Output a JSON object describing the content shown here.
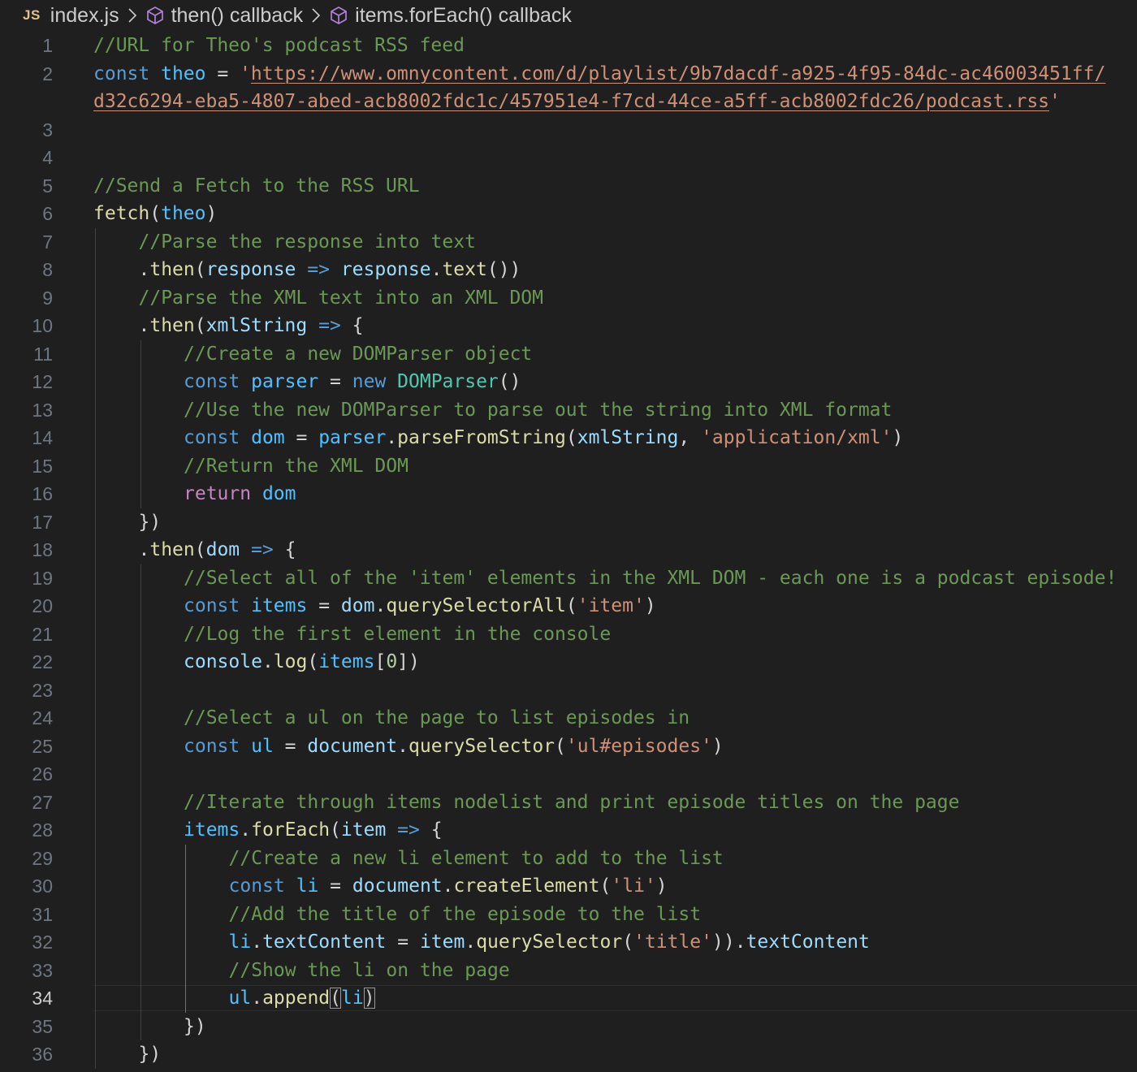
{
  "breadcrumb": {
    "file_badge": "JS",
    "file_name": "index.js",
    "crumbs": [
      "then() callback",
      "items.forEach() callback"
    ]
  },
  "editor": {
    "language": "javascript",
    "active_line": 34,
    "lines": [
      {
        "n": "1",
        "indent": 0,
        "tokens": [
          [
            "cmt",
            "//URL for Theo's podcast RSS feed"
          ]
        ]
      },
      {
        "n": "2",
        "indent": 0,
        "tokens": [
          [
            "kw",
            "const"
          ],
          [
            "pun",
            " "
          ],
          [
            "var",
            "theo"
          ],
          [
            "pun",
            " = "
          ],
          [
            "str",
            "'"
          ],
          [
            "url",
            "https://www.omnycontent.com/d/playlist/9b7dacdf-a925-4f95-84dc-ac46003451ff/"
          ]
        ]
      },
      {
        "n": "",
        "indent": 0,
        "tokens": [
          [
            "url",
            "d32c6294-eba5-4807-abed-acb8002fdc1c/457951e4-f7cd-44ce-a5ff-acb8002fdc26/podcast.rss"
          ],
          [
            "str",
            "'"
          ]
        ]
      },
      {
        "n": "3",
        "indent": 0,
        "tokens": []
      },
      {
        "n": "4",
        "indent": 0,
        "tokens": []
      },
      {
        "n": "5",
        "indent": 0,
        "tokens": [
          [
            "cmt",
            "//Send a Fetch to the RSS URL"
          ]
        ]
      },
      {
        "n": "6",
        "indent": 0,
        "tokens": [
          [
            "fn",
            "fetch"
          ],
          [
            "pun",
            "("
          ],
          [
            "var",
            "theo"
          ],
          [
            "pun",
            ")"
          ]
        ]
      },
      {
        "n": "7",
        "indent": 1,
        "tokens": [
          [
            "cmt",
            "//Parse the response into text"
          ]
        ]
      },
      {
        "n": "8",
        "indent": 1,
        "tokens": [
          [
            "pun",
            "."
          ],
          [
            "fn",
            "then"
          ],
          [
            "pun",
            "("
          ],
          [
            "prm",
            "response"
          ],
          [
            "pun",
            " "
          ],
          [
            "kw",
            "=>"
          ],
          [
            "pun",
            " "
          ],
          [
            "prm",
            "response"
          ],
          [
            "pun",
            "."
          ],
          [
            "fn",
            "text"
          ],
          [
            "pun",
            "())"
          ]
        ]
      },
      {
        "n": "9",
        "indent": 1,
        "tokens": [
          [
            "cmt",
            "//Parse the XML text into an XML DOM"
          ]
        ]
      },
      {
        "n": "10",
        "indent": 1,
        "tokens": [
          [
            "pun",
            "."
          ],
          [
            "fn",
            "then"
          ],
          [
            "pun",
            "("
          ],
          [
            "prm",
            "xmlString"
          ],
          [
            "pun",
            " "
          ],
          [
            "kw",
            "=>"
          ],
          [
            "pun",
            " {"
          ]
        ]
      },
      {
        "n": "11",
        "indent": 2,
        "tokens": [
          [
            "cmt",
            "//Create a new DOMParser object"
          ]
        ]
      },
      {
        "n": "12",
        "indent": 2,
        "tokens": [
          [
            "kw",
            "const"
          ],
          [
            "pun",
            " "
          ],
          [
            "var",
            "parser"
          ],
          [
            "pun",
            " = "
          ],
          [
            "kw",
            "new"
          ],
          [
            "pun",
            " "
          ],
          [
            "cls",
            "DOMParser"
          ],
          [
            "pun",
            "()"
          ]
        ]
      },
      {
        "n": "13",
        "indent": 2,
        "tokens": [
          [
            "cmt",
            "//Use the new DOMParser to parse out the string into XML format"
          ]
        ]
      },
      {
        "n": "14",
        "indent": 2,
        "tokens": [
          [
            "kw",
            "const"
          ],
          [
            "pun",
            " "
          ],
          [
            "var",
            "dom"
          ],
          [
            "pun",
            " = "
          ],
          [
            "var",
            "parser"
          ],
          [
            "pun",
            "."
          ],
          [
            "fn",
            "parseFromString"
          ],
          [
            "pun",
            "("
          ],
          [
            "prm",
            "xmlString"
          ],
          [
            "pun",
            ", "
          ],
          [
            "str",
            "'application/xml'"
          ],
          [
            "pun",
            ")"
          ]
        ]
      },
      {
        "n": "15",
        "indent": 2,
        "tokens": [
          [
            "cmt",
            "//Return the XML DOM"
          ]
        ]
      },
      {
        "n": "16",
        "indent": 2,
        "tokens": [
          [
            "ctl",
            "return"
          ],
          [
            "pun",
            " "
          ],
          [
            "var",
            "dom"
          ]
        ]
      },
      {
        "n": "17",
        "indent": 1,
        "tokens": [
          [
            "pun",
            "})"
          ]
        ]
      },
      {
        "n": "18",
        "indent": 1,
        "tokens": [
          [
            "pun",
            "."
          ],
          [
            "fn",
            "then"
          ],
          [
            "pun",
            "("
          ],
          [
            "prm",
            "dom"
          ],
          [
            "pun",
            " "
          ],
          [
            "kw",
            "=>"
          ],
          [
            "pun",
            " {"
          ]
        ]
      },
      {
        "n": "19",
        "indent": 2,
        "tokens": [
          [
            "cmt",
            "//Select all of the 'item' elements in the XML DOM - each one is a podcast episode!"
          ]
        ]
      },
      {
        "n": "20",
        "indent": 2,
        "tokens": [
          [
            "kw",
            "const"
          ],
          [
            "pun",
            " "
          ],
          [
            "var",
            "items"
          ],
          [
            "pun",
            " = "
          ],
          [
            "prm",
            "dom"
          ],
          [
            "pun",
            "."
          ],
          [
            "fn",
            "querySelectorAll"
          ],
          [
            "pun",
            "("
          ],
          [
            "str",
            "'item'"
          ],
          [
            "pun",
            ")"
          ]
        ]
      },
      {
        "n": "21",
        "indent": 2,
        "tokens": [
          [
            "cmt",
            "//Log the first element in the console"
          ]
        ]
      },
      {
        "n": "22",
        "indent": 2,
        "tokens": [
          [
            "prm",
            "console"
          ],
          [
            "pun",
            "."
          ],
          [
            "fn",
            "log"
          ],
          [
            "pun",
            "("
          ],
          [
            "var",
            "items"
          ],
          [
            "pun",
            "["
          ],
          [
            "num",
            "0"
          ],
          [
            "pun",
            "])"
          ]
        ]
      },
      {
        "n": "23",
        "indent": 2,
        "tokens": []
      },
      {
        "n": "24",
        "indent": 2,
        "tokens": [
          [
            "cmt",
            "//Select a ul on the page to list episodes in"
          ]
        ]
      },
      {
        "n": "25",
        "indent": 2,
        "tokens": [
          [
            "kw",
            "const"
          ],
          [
            "pun",
            " "
          ],
          [
            "var",
            "ul"
          ],
          [
            "pun",
            " = "
          ],
          [
            "prm",
            "document"
          ],
          [
            "pun",
            "."
          ],
          [
            "fn",
            "querySelector"
          ],
          [
            "pun",
            "("
          ],
          [
            "str",
            "'ul#episodes'"
          ],
          [
            "pun",
            ")"
          ]
        ]
      },
      {
        "n": "26",
        "indent": 2,
        "tokens": []
      },
      {
        "n": "27",
        "indent": 2,
        "tokens": [
          [
            "cmt",
            "//Iterate through items nodelist and print episode titles on the page"
          ]
        ]
      },
      {
        "n": "28",
        "indent": 2,
        "tokens": [
          [
            "var",
            "items"
          ],
          [
            "pun",
            "."
          ],
          [
            "fn",
            "forEach"
          ],
          [
            "pun",
            "("
          ],
          [
            "prm",
            "item"
          ],
          [
            "pun",
            " "
          ],
          [
            "kw",
            "=>"
          ],
          [
            "pun",
            " {"
          ]
        ]
      },
      {
        "n": "29",
        "indent": 3,
        "tokens": [
          [
            "cmt",
            "//Create a new li element to add to the list"
          ]
        ]
      },
      {
        "n": "30",
        "indent": 3,
        "tokens": [
          [
            "kw",
            "const"
          ],
          [
            "pun",
            " "
          ],
          [
            "var",
            "li"
          ],
          [
            "pun",
            " = "
          ],
          [
            "prm",
            "document"
          ],
          [
            "pun",
            "."
          ],
          [
            "fn",
            "createElement"
          ],
          [
            "pun",
            "("
          ],
          [
            "str",
            "'li'"
          ],
          [
            "pun",
            ")"
          ]
        ]
      },
      {
        "n": "31",
        "indent": 3,
        "tokens": [
          [
            "cmt",
            "//Add the title of the episode to the list"
          ]
        ]
      },
      {
        "n": "32",
        "indent": 3,
        "tokens": [
          [
            "var",
            "li"
          ],
          [
            "pun",
            "."
          ],
          [
            "prm",
            "textContent"
          ],
          [
            "pun",
            " = "
          ],
          [
            "prm",
            "item"
          ],
          [
            "pun",
            "."
          ],
          [
            "fn",
            "querySelector"
          ],
          [
            "pun",
            "("
          ],
          [
            "str",
            "'title'"
          ],
          [
            "pun",
            "))."
          ],
          [
            "prm",
            "textContent"
          ]
        ]
      },
      {
        "n": "33",
        "indent": 3,
        "tokens": [
          [
            "cmt",
            "//Show the li on the page"
          ]
        ]
      },
      {
        "n": "34",
        "indent": 3,
        "tokens": [
          [
            "var",
            "ul"
          ],
          [
            "pun",
            "."
          ],
          [
            "fn",
            "append"
          ],
          [
            "brk",
            "("
          ],
          [
            "var",
            "li"
          ],
          [
            "brk",
            ")"
          ]
        ]
      },
      {
        "n": "35",
        "indent": 2,
        "tokens": [
          [
            "pun",
            "})"
          ]
        ]
      },
      {
        "n": "36",
        "indent": 1,
        "tokens": [
          [
            "pun",
            "})"
          ]
        ]
      }
    ]
  }
}
